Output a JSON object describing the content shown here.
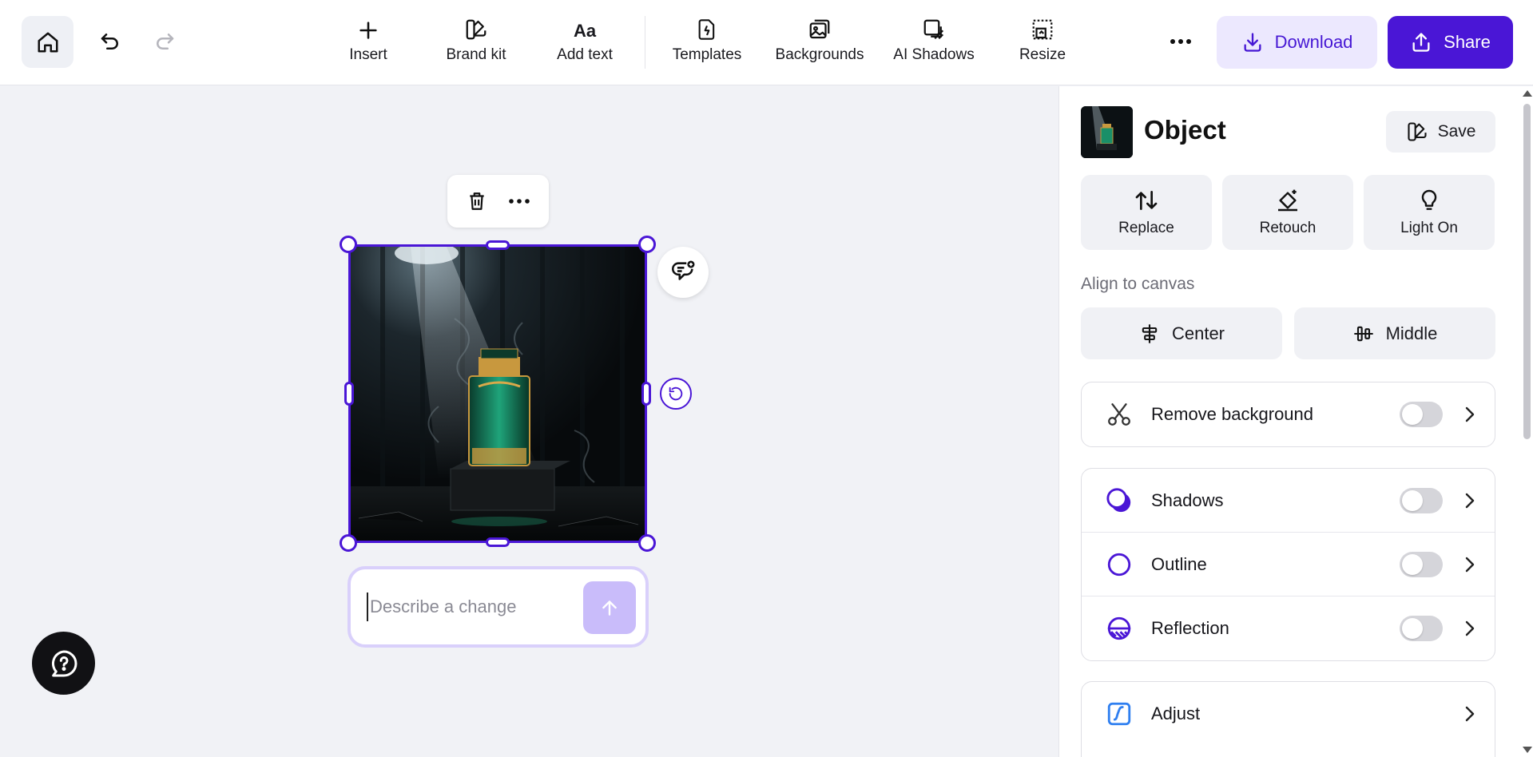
{
  "toolbar": {
    "home_icon": "home-icon",
    "undo_icon": "undo-icon",
    "redo_icon": "redo-icon",
    "tools": [
      {
        "label": "Insert",
        "icon": "plus-icon"
      },
      {
        "label": "Brand kit",
        "icon": "brand-kit-icon"
      },
      {
        "label": "Add text",
        "icon_text": "Aa"
      },
      {
        "label": "Templates",
        "icon": "templates-icon"
      },
      {
        "label": "Backgrounds",
        "icon": "backgrounds-icon"
      },
      {
        "label": "AI Shadows",
        "icon": "ai-shadows-icon"
      },
      {
        "label": "Resize",
        "icon": "resize-icon"
      }
    ],
    "download_label": "Download",
    "share_label": "Share",
    "colors": {
      "accent": "#4a16d6",
      "download_bg": "#ece8fe"
    }
  },
  "canvas": {
    "prompt_placeholder": "Describe a change",
    "prompt_value": ""
  },
  "panel": {
    "title": "Object",
    "save_label": "Save",
    "actions": [
      {
        "label": "Replace",
        "icon": "replace-icon"
      },
      {
        "label": "Retouch",
        "icon": "eraser-icon"
      },
      {
        "label": "Light On",
        "icon": "lightbulb-icon"
      }
    ],
    "align_label": "Align to canvas",
    "align_buttons": [
      {
        "label": "Center",
        "icon": "align-center-icon"
      },
      {
        "label": "Middle",
        "icon": "align-middle-icon"
      }
    ],
    "remove_background": {
      "label": "Remove background",
      "enabled": false
    },
    "effects": [
      {
        "label": "Shadows",
        "enabled": false,
        "icon": "shadows-icon"
      },
      {
        "label": "Outline",
        "enabled": false,
        "icon": "outline-icon"
      },
      {
        "label": "Reflection",
        "enabled": false,
        "icon": "reflection-icon"
      }
    ],
    "adjust": {
      "label": "Adjust",
      "icon": "adjust-icon"
    }
  }
}
